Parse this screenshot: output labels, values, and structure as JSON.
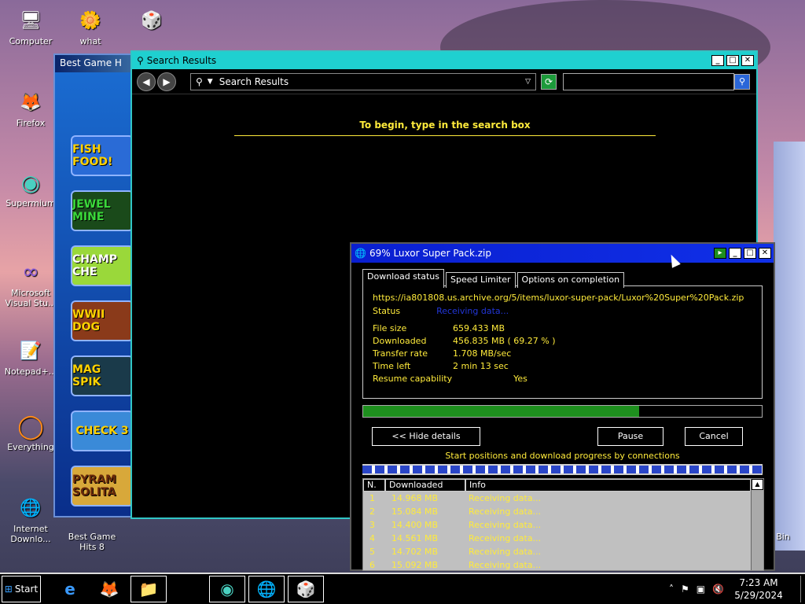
{
  "desktop": {
    "icons": [
      {
        "name": "computer",
        "label": "Computer",
        "glyph": "🖥"
      },
      {
        "name": "what",
        "label": "what",
        "glyph": "🌼"
      },
      {
        "name": "dice",
        "label": "",
        "glyph": "🎲"
      },
      {
        "name": "firefox",
        "label": "Firefox",
        "glyph": "🦊"
      },
      {
        "name": "supermium",
        "label": "Supermium",
        "glyph": "◉"
      },
      {
        "name": "visual-studio",
        "label": "Microsoft Visual Stu...",
        "glyph": "∞"
      },
      {
        "name": "notepad",
        "label": "Notepad+...",
        "glyph": "📝"
      },
      {
        "name": "everything",
        "label": "Everything",
        "glyph": "◯"
      },
      {
        "name": "idm",
        "label": "Internet Downlo...",
        "glyph": "🌐"
      },
      {
        "name": "best-game-hits",
        "label": "Best Game Hits 8",
        "glyph": "🎮"
      },
      {
        "name": "recycle-bin",
        "label": "Bin",
        "glyph": ""
      }
    ]
  },
  "best_game_window": {
    "title": "Best Game H",
    "tiles": [
      "FISH FOOD!",
      "JEWEL MINE",
      "CHAMP CHE",
      "WWII DOG",
      "MAG SPIK",
      "CHECK 3",
      "PYRAM SOLITA"
    ]
  },
  "search_window": {
    "title": "Search Results",
    "address_label": "Search Results",
    "search_placeholder": "",
    "hint": "To begin, type in the search box"
  },
  "download": {
    "title": "69% Luxor Super Pack.zip",
    "tabs": [
      "Download status",
      "Speed Limiter",
      "Options on completion"
    ],
    "url": "https://ia801808.us.archive.org/5/items/luxor-super-pack/Luxor%20Super%20Pack.zip",
    "status_label": "Status",
    "status_value": "Receiving data...",
    "file_size_label": "File size",
    "file_size_value": "659.433 MB",
    "downloaded_label": "Downloaded",
    "downloaded_value": "456.835 MB  ( 69.27 % )",
    "transfer_label": "Transfer rate",
    "transfer_value": "1.708  MB/sec",
    "time_left_label": "Time left",
    "time_left_value": "2 min 13 sec",
    "resume_label": "Resume capability",
    "resume_value": "Yes",
    "progress": 0.6927,
    "hide_details": "<< Hide details",
    "pause": "Pause",
    "cancel": "Cancel",
    "connections_label": "Start positions and download progress by connections",
    "table_headers": [
      "N.",
      "Downloaded",
      "Info"
    ],
    "rows": [
      {
        "n": "1",
        "downloaded": "14.968  MB",
        "info": "Receiving data..."
      },
      {
        "n": "2",
        "downloaded": "15.084  MB",
        "info": "Receiving data..."
      },
      {
        "n": "3",
        "downloaded": "14.400  MB",
        "info": "Receiving data..."
      },
      {
        "n": "4",
        "downloaded": "14.561  MB",
        "info": "Receiving data..."
      },
      {
        "n": "5",
        "downloaded": "14.702  MB",
        "info": "Receiving data..."
      },
      {
        "n": "6",
        "downloaded": "15.092  MB",
        "info": "Receiving data..."
      }
    ]
  },
  "taskbar": {
    "start_label": "Start",
    "apps": [
      "ie",
      "firefox",
      "explorer",
      "media",
      "supermium",
      "idm",
      "dice"
    ],
    "time": "7:23 AM",
    "date": "5/29/2024"
  },
  "colors": {
    "accent_yellow": "#ffeb3b",
    "progress_green": "#1e8f1e",
    "title_blue": "#0a1fd0",
    "search_title_cyan": "#1fd0d0"
  }
}
